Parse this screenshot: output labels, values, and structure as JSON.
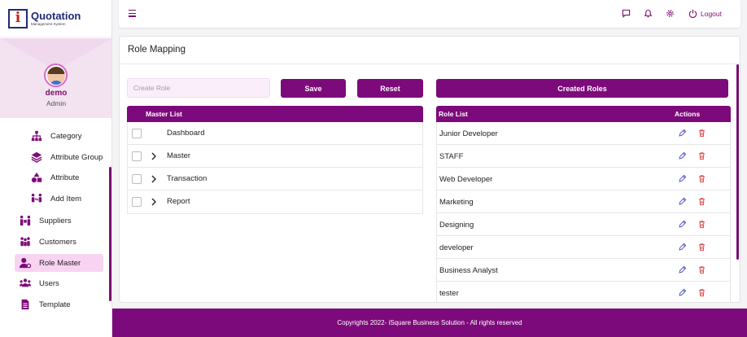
{
  "brand": {
    "title": "Quotation",
    "subtitle": "Management System",
    "mark_letter": "i"
  },
  "profile": {
    "name": "demo",
    "role": "Admin"
  },
  "sidebar": {
    "items": [
      {
        "label": "Category",
        "icon": "sitemap-icon"
      },
      {
        "label": "Attribute Group",
        "icon": "layers-icon"
      },
      {
        "label": "Attribute",
        "icon": "shapes-icon"
      },
      {
        "label": "Add Item",
        "icon": "people-arrows-icon"
      },
      {
        "label": "Suppliers",
        "icon": "people-carry-icon"
      },
      {
        "label": "Customers",
        "icon": "user-friends-icon"
      },
      {
        "label": "Role Master",
        "icon": "user-cog-icon",
        "active": true
      },
      {
        "label": "Users",
        "icon": "users-icon"
      },
      {
        "label": "Template",
        "icon": "document-icon"
      }
    ]
  },
  "header": {
    "logout_label": "Logout"
  },
  "page": {
    "title": "Role Mapping",
    "role_input_placeholder": "Create Role",
    "role_input_value": "",
    "save_label": "Save",
    "reset_label": "Reset",
    "created_roles_label": "Created Roles"
  },
  "master_list": {
    "header": "Master List",
    "rows": [
      {
        "label": "Dashboard",
        "expandable": false
      },
      {
        "label": "Master",
        "expandable": true
      },
      {
        "label": "Transaction",
        "expandable": true
      },
      {
        "label": "Report",
        "expandable": true
      }
    ]
  },
  "role_list": {
    "header": "Role List",
    "actions_header": "Actions",
    "rows": [
      "Junior Developer",
      "STAFF",
      "Web Developer",
      "Marketing",
      "Designing",
      "developer",
      "Business Analyst",
      "tester"
    ]
  },
  "footer": {
    "text": "Copyrights 2022- iSquare Business Solution - All rights reserved"
  },
  "colors": {
    "primary": "#7d0a7a",
    "active_bg": "#f8d4f2",
    "delete": "#d9534f",
    "edit": "#5a5fc9",
    "brand_blue": "#1e2a78",
    "brand_red": "#c81e1e"
  }
}
